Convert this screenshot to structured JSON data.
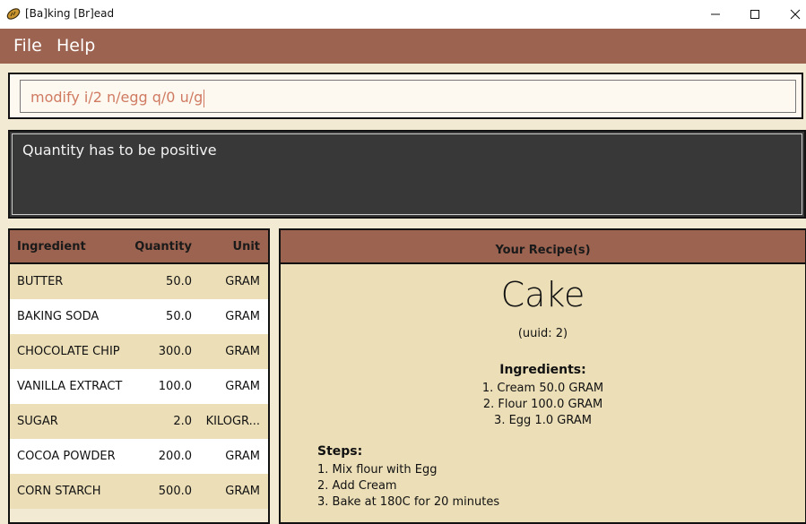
{
  "window": {
    "title": "[Ba]king [Br]ead",
    "icon": "bread-icon",
    "controls": [
      "minimize-icon",
      "maximize-icon",
      "close-icon"
    ]
  },
  "menu": {
    "file": "File",
    "help": "Help"
  },
  "command": {
    "value": "modify i/2 n/egg q/0 u/g"
  },
  "result": {
    "message": "Quantity has to be positive"
  },
  "ingredients": {
    "headers": {
      "name": "Ingredient",
      "quantity": "Quantity",
      "unit": "Unit"
    },
    "rows": [
      {
        "name": "BUTTER",
        "quantity": "50.0",
        "unit": "GRAM"
      },
      {
        "name": "BAKING SODA",
        "quantity": "50.0",
        "unit": "GRAM"
      },
      {
        "name": "CHOCOLATE CHIP",
        "quantity": "300.0",
        "unit": "GRAM"
      },
      {
        "name": "VANILLA EXTRACT",
        "quantity": "100.0",
        "unit": "GRAM"
      },
      {
        "name": "SUGAR",
        "quantity": "2.0",
        "unit": "KILOGR..."
      },
      {
        "name": "COCOA POWDER",
        "quantity": "200.0",
        "unit": "GRAM"
      },
      {
        "name": "CORN STARCH",
        "quantity": "500.0",
        "unit": "GRAM"
      }
    ]
  },
  "recipe": {
    "header": "Your Recipe(s)",
    "name": "Cake",
    "uuid": "(uuid: 2)",
    "ingredients_title": "Ingredients:",
    "ingredients": [
      "1. Cream 50.0 GRAM",
      "2. Flour 100.0 GRAM",
      "3. Egg 1.0 GRAM"
    ],
    "steps_title": "Steps:",
    "steps": [
      "1. Mix flour with Egg",
      "2. Add Cream",
      "3. Bake at 180C for 20 minutes"
    ]
  },
  "colors": {
    "accent": "#9c6350",
    "row_alt": "#ecdfb8",
    "result_bg": "#383838",
    "command_text": "#d07a62"
  }
}
